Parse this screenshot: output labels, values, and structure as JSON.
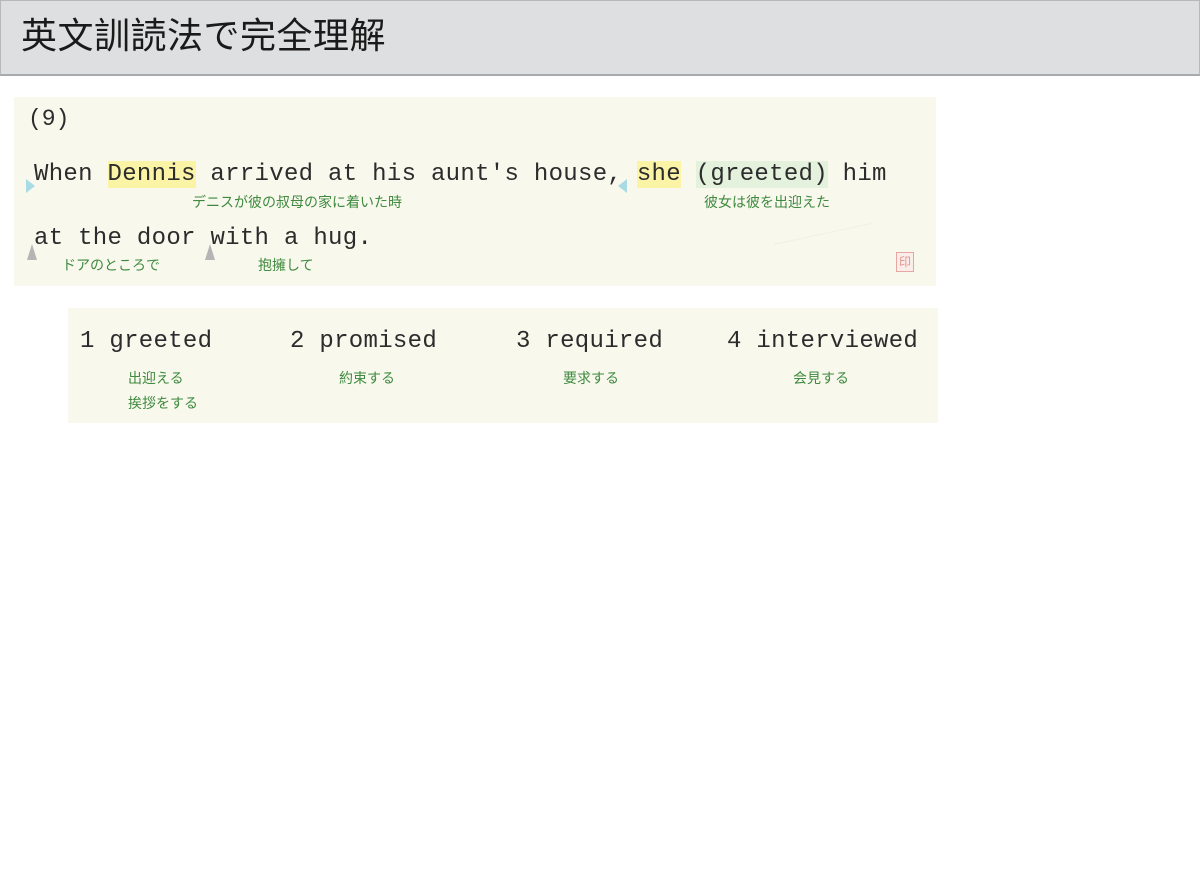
{
  "header": {
    "title": "英文訓読法で完全理解"
  },
  "question": {
    "number": "(9)",
    "line1": {
      "when": "When ",
      "dennis": "Dennis",
      "arrived": " arrived at his aunt's house, ",
      "she": "she",
      "space": " ",
      "greeted": "(greeted)",
      "him": " him"
    },
    "line2": {
      "at": "at the door ",
      "with": "with a hug."
    },
    "glosses": {
      "when_clause": "デニスが彼の叔母の家に着いた時",
      "main_clause": "彼女は彼を出迎えた",
      "at_door": "ドアのところで",
      "with_hug": "抱擁して"
    }
  },
  "choices": [
    {
      "label": "1 greeted",
      "gloss1": "出迎える",
      "gloss2": "挨拶をする"
    },
    {
      "label": "2 promised",
      "gloss1": "約束する"
    },
    {
      "label": "3 required",
      "gloss1": "要求する"
    },
    {
      "label": "4 interviewed",
      "gloss1": "会見する"
    }
  ],
  "colors": {
    "header_bg": "#dedfe0",
    "panel_bg": "#f8f8ed",
    "highlight_yellow": "#fbf3a6",
    "highlight_green": "#e3f1dd",
    "gloss_green": "#3f8a3f"
  }
}
